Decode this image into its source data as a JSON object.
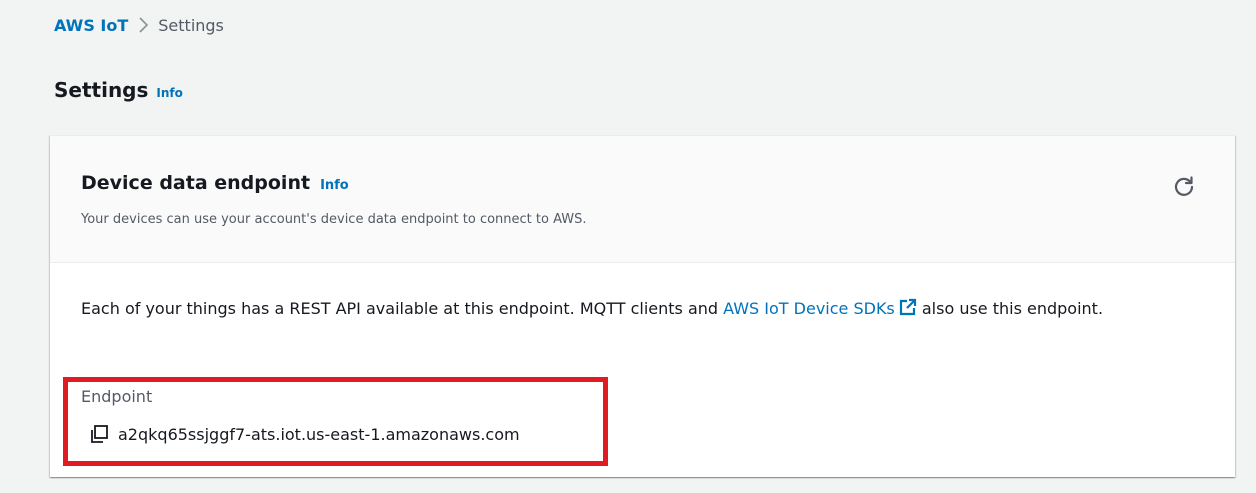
{
  "breadcrumb": {
    "root": "AWS IoT",
    "current": "Settings"
  },
  "page": {
    "title": "Settings",
    "info": "Info"
  },
  "card": {
    "title": "Device data endpoint",
    "info": "Info",
    "description": "Your devices can use your account's device data endpoint to connect to AWS.",
    "refresh_icon": "refresh-icon",
    "body_text_before": "Each of your things has a REST API available at this endpoint. MQTT clients and ",
    "body_link": "AWS IoT Device SDKs",
    "body_link_icon": "external-link-icon",
    "body_text_after": " also use this endpoint.",
    "endpoint_label": "Endpoint",
    "copy_icon": "copy-icon",
    "endpoint_value": "a2qkq65ssjggf7-ats.iot.us-east-1.amazonaws.com"
  },
  "colors": {
    "link": "#0073bb",
    "highlight_border": "#e11b22",
    "background": "#f2f3f3"
  }
}
